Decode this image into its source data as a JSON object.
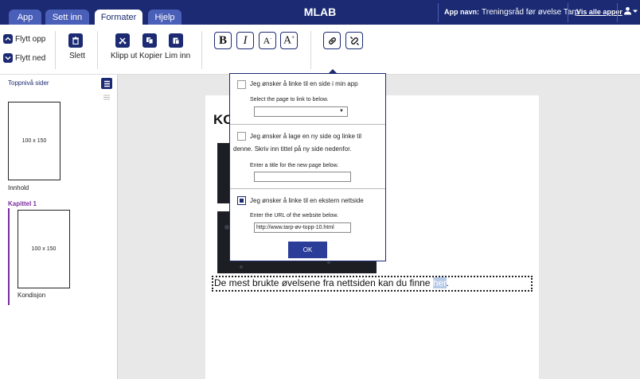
{
  "header": {
    "tabs": [
      {
        "label": "App"
      },
      {
        "label": "Sett inn"
      },
      {
        "label": "Formater"
      },
      {
        "label": "Hjelp"
      }
    ],
    "brand": "MLAB",
    "app_name_label": "App navn:",
    "app_name_value": "Treningsråd før øvelse Tarp",
    "see_all_apps": "Vis alle apper"
  },
  "toolbar": {
    "move_up": "Flytt opp",
    "move_down": "Flytt ned",
    "delete": "Slett",
    "cut": "Klipp ut",
    "copy": "Kopier",
    "paste": "Lim inn"
  },
  "sidebar": {
    "top_level_label": "Toppnivå sider",
    "pages": [
      {
        "thumb": "100 x 150",
        "name": "Innhold"
      }
    ],
    "chapters": [
      {
        "title": "Kapittel 1",
        "pages": [
          {
            "thumb": "100 x 150",
            "name": "Kondisjon"
          }
        ]
      }
    ]
  },
  "editor": {
    "heading_visible": "KO",
    "paragraph_text": "De mest brukte øvelsene fra nettsiden kan du finne ",
    "paragraph_link": "her",
    "paragraph_end": "."
  },
  "link_popup": {
    "option1_label": "Jeg ønsker å linke til en side i min app",
    "option1_sub": "Select the page to link to below.",
    "option1_select_value": "",
    "option1_checked": false,
    "option2_label_line1": "Jeg ønsker å lage en ny side og linke til",
    "option2_label_line2": "denne. Skriv inn tittel på ny side nedenfor.",
    "option2_sub": "Enter a title for the new page below.",
    "option2_value": "",
    "option2_checked": false,
    "option3_label": "Jeg ønsker å linke til en ekstern nettside",
    "option3_sub": "Enter the URL of the website below.",
    "option3_value": "http://www.tarp-øv-topp-10.html",
    "option3_checked": true,
    "ok_label": "OK"
  },
  "colors": {
    "primary": "#1b2a73",
    "tab_inactive": "#4a5fb8",
    "chapter_accent": "#7a2ea0",
    "editor_bg": "#e8e8e8"
  }
}
